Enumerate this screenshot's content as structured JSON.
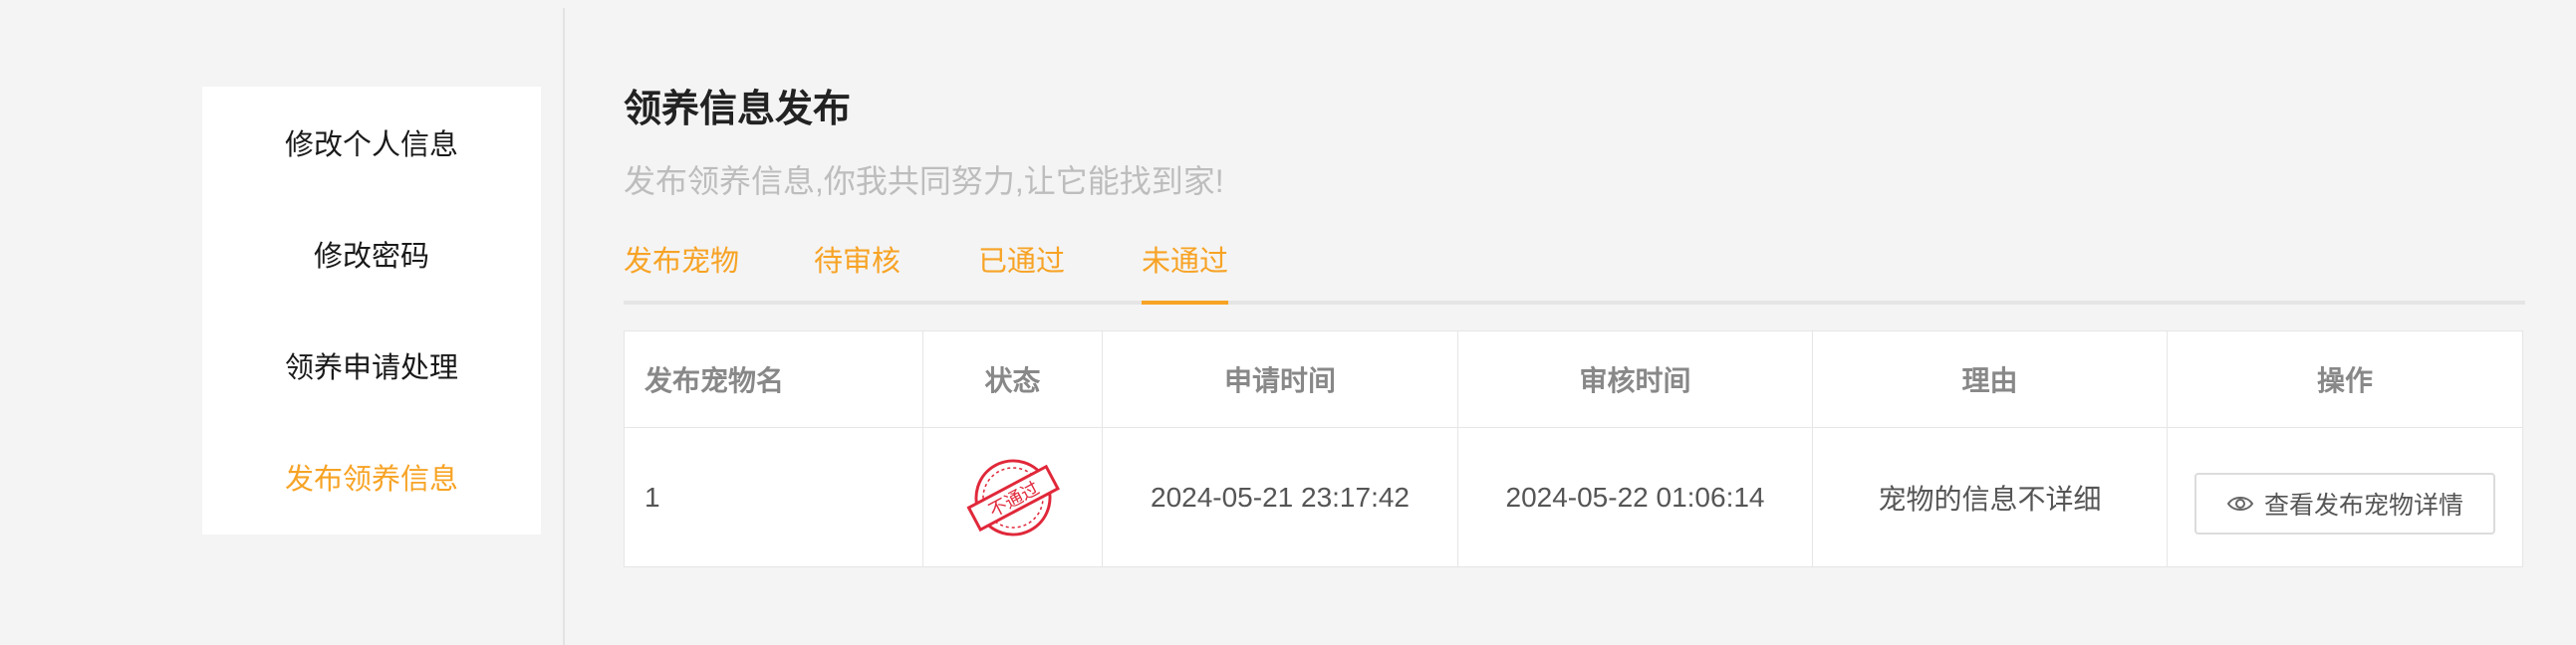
{
  "sidebar": {
    "items": [
      {
        "label": "修改个人信息"
      },
      {
        "label": "修改密码"
      },
      {
        "label": "领养申请处理"
      },
      {
        "label": "发布领养信息",
        "active": true
      }
    ]
  },
  "main": {
    "title": "领养信息发布",
    "subtitle": "发布领养信息,你我共同努力,让它能找到家!",
    "tabs": [
      {
        "label": "发布宠物"
      },
      {
        "label": "待审核"
      },
      {
        "label": "已通过"
      },
      {
        "label": "未通过",
        "active": true
      }
    ]
  },
  "table": {
    "columns": [
      "发布宠物名",
      "状态",
      "申请时间",
      "审核时间",
      "理由",
      "操作"
    ],
    "rows": [
      {
        "pet_name": "1",
        "status_stamp": "不通过",
        "apply_time": "2024-05-21 23:17:42",
        "review_time": "2024-05-22 01:06:14",
        "reason": "宠物的信息不详细",
        "action_label": "查看发布宠物详情"
      }
    ]
  },
  "colors": {
    "accent": "#f7a325",
    "stamp_red": "#e0283a"
  }
}
